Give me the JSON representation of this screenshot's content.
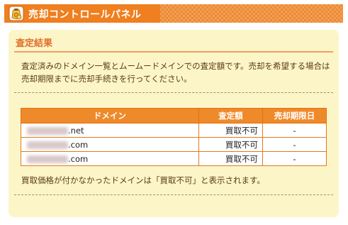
{
  "header": {
    "title": "売却コントロールパネル",
    "icon": "coin-bag-icon",
    "accent_color": "#ef7f1f"
  },
  "panel": {
    "section_title": "査定結果",
    "description": "査定済みのドメイン一覧とムームードメインでの査定額です。売却を希望する場合は売却期限までに売却手続きを行ってください。",
    "table": {
      "headers": [
        "ドメイン",
        "査定額",
        "売却期限日"
      ],
      "rows": [
        {
          "domain": ".net",
          "price": "買取不可",
          "deadline": "-"
        },
        {
          "domain": ".com",
          "price": "買取不可",
          "deadline": "-"
        },
        {
          "domain": ".com",
          "price": "買取不可",
          "deadline": "-"
        }
      ]
    },
    "note": "買取価格が付かなかったドメインは「買取不可」と表示されます。"
  }
}
